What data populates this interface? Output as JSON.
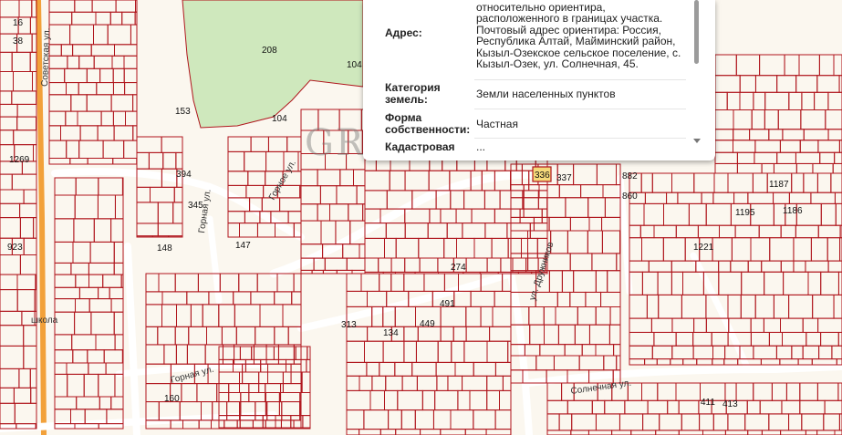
{
  "popup": {
    "rows": [
      {
        "key": "Адрес:",
        "value_lines": [
          "относительно ориентира,",
          "расположенного в границах участка.",
          "Почтовый адрес ориентира: Россия,",
          "Республика Алтай, Майминский район,",
          "Кызыл-Озекское сельское поселение, с.",
          "Кызыл-Озек, ул. Солнечная, 45."
        ]
      },
      {
        "key": "Категория земель:",
        "value_lines": [
          "Земли населенных пунктов"
        ]
      },
      {
        "key": "Форма собственности:",
        "value_lines": [
          "Частная"
        ]
      },
      {
        "key": "Кадастровая",
        "value_lines": [
          "..."
        ]
      }
    ]
  },
  "watermark": "GRAVITON",
  "streets": {
    "sovetskaya": "Советская ул.",
    "gornaya": "Горная ул.",
    "gornaya2": "Горная ул.",
    "solnechnaya": "Солнечная ул.",
    "dr": "ул. Дружников",
    "school": "школа",
    "gornoe": "Горное ул."
  },
  "labels": {
    "n208": "208",
    "n104a": "104",
    "n104b": "104",
    "n148": "148",
    "n336": "336",
    "n337": "337",
    "n1187": "1187",
    "n882": "882",
    "n860": "860",
    "n394": "394",
    "n345": "345",
    "n147": "147",
    "n313": "313",
    "n134": "134",
    "n449": "449",
    "n491": "491",
    "n274": "274",
    "n1195": "1195",
    "n1186": "1186",
    "n1221": "1221",
    "n411": "411",
    "n413": "413",
    "n16": "16",
    "n38": "38",
    "n1269": "1269",
    "n923": "923",
    "n153": "153",
    "n160": "160"
  },
  "colors": {
    "parcel": "#b0161d",
    "forest": "#cfe8bd",
    "road": "#ffffff",
    "highway": "#f2a13a",
    "selected": "#f5d97a"
  }
}
